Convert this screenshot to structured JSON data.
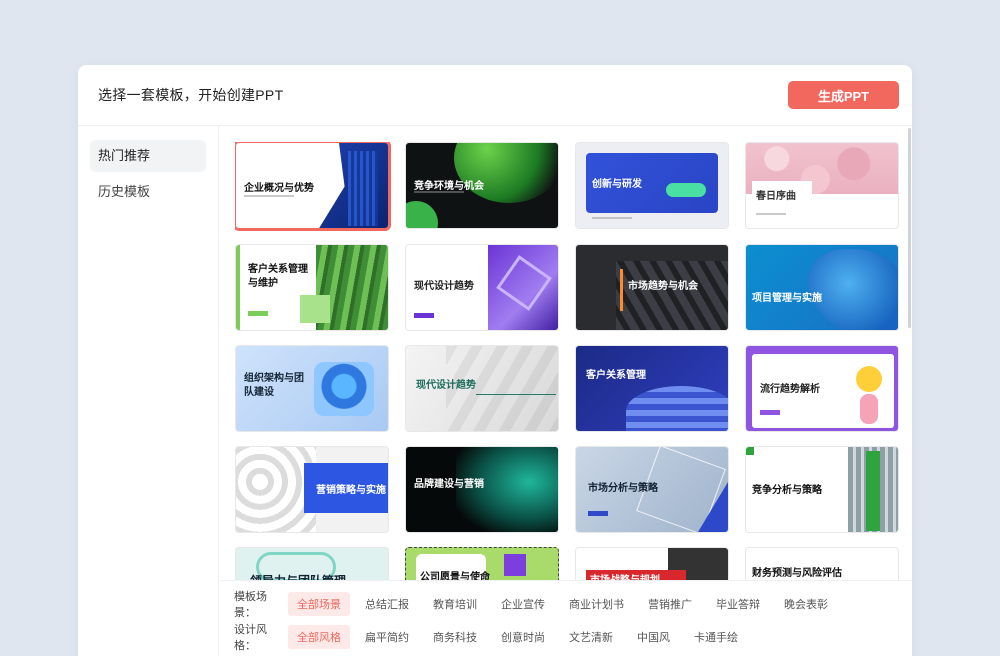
{
  "header": {
    "title": "选择一套模板，开始创建PPT",
    "generate_label": "生成PPT"
  },
  "sidebar": {
    "items": [
      {
        "label": "热门推荐",
        "active": true
      },
      {
        "label": "历史模板",
        "active": false
      }
    ]
  },
  "templates": [
    {
      "title": "企业概况与优势",
      "theme": "white-blue-building",
      "selected": true
    },
    {
      "title": "竞争环境与机会",
      "theme": "dark-green-orb"
    },
    {
      "title": "创新与研发",
      "theme": "blue-tablet"
    },
    {
      "title": "春日序曲",
      "theme": "cherry-blossom"
    },
    {
      "title": "客户关系管理与维护",
      "theme": "green-leaves"
    },
    {
      "title": "现代设计趋势",
      "theme": "purple-crystal"
    },
    {
      "title": "市场趋势与机会",
      "theme": "dark-orange-bar"
    },
    {
      "title": "项目管理与实施",
      "theme": "blue-waves"
    },
    {
      "title": "组织架构与团队建设",
      "theme": "blue-3d-button"
    },
    {
      "title": "现代设计趋势",
      "theme": "grey-shadow"
    },
    {
      "title": "客户关系管理",
      "theme": "navy-3d-ribbon"
    },
    {
      "title": "流行趋势解析",
      "theme": "purple-emoji"
    },
    {
      "title": "营销策略与实施",
      "theme": "white-knots-blue"
    },
    {
      "title": "品牌建设与营销",
      "theme": "black-teal-noise"
    },
    {
      "title": "市场分析与策略",
      "theme": "grey-network"
    },
    {
      "title": "竞争分析与策略",
      "theme": "green-building"
    },
    {
      "title": "领导力与团队管理",
      "theme": "teal-partial"
    },
    {
      "title": "公司愿景与使命",
      "theme": "colorful-partial"
    },
    {
      "title": "市场战略与规划",
      "theme": "red-partial"
    },
    {
      "title": "财务预测与风险评估",
      "theme": "white-partial"
    }
  ],
  "filters": {
    "scene": {
      "label": "模板场景：",
      "options": [
        "全部场景",
        "总结汇报",
        "教育培训",
        "企业宣传",
        "商业计划书",
        "营销推广",
        "毕业答辩",
        "晚会表彰"
      ],
      "active": 0
    },
    "style": {
      "label": "设计风格：",
      "options": [
        "全部风格",
        "扁平简约",
        "商务科技",
        "创意时尚",
        "文艺清新",
        "中国风",
        "卡通手绘"
      ],
      "active": 0
    }
  },
  "colors": {
    "accent": "#f2685f",
    "chip_bg": "#fde9e7"
  }
}
